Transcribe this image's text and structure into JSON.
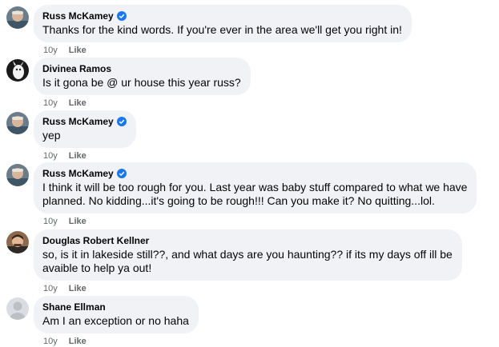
{
  "comments": [
    {
      "author": "Russ McKamey",
      "verified": true,
      "text": "Thanks for the kind words. If you're ever in the area we'll get you right in!",
      "time": "10y",
      "like_label": "Like",
      "avatar": "russ-avatar"
    },
    {
      "author": "Divinea Ramos",
      "verified": false,
      "text": "Is it gona be @ ur house this year russ?",
      "time": "10y",
      "like_label": "Like",
      "avatar": "divinea-avatar"
    },
    {
      "author": "Russ McKamey",
      "verified": true,
      "text": "yep",
      "time": "10y",
      "like_label": "Like",
      "avatar": "russ-avatar"
    },
    {
      "author": "Russ McKamey",
      "verified": true,
      "text_lines": [
        "I think it will be too rough for you. Last year was baby stuff compared to what we have",
        "planned. No kidding...it's going to be rough!!! Can you make it? No quitting...lol."
      ],
      "time": "10y",
      "like_label": "Like",
      "avatar": "russ-avatar"
    },
    {
      "author": "Douglas Robert Kellner",
      "verified": false,
      "text_lines": [
        "so, is it in lakeside still??, and what days are you haunting?? if its my days off ill be",
        "avaible to help ya out!"
      ],
      "time": "10y",
      "like_label": "Like",
      "avatar": "douglas-avatar"
    },
    {
      "author": "Shane Ellman",
      "verified": false,
      "text": "Am I an exception or no haha",
      "time": "10y",
      "like_label": "Like",
      "avatar": "default-avatar"
    }
  ],
  "colors": {
    "bubble": "#f0f2f5",
    "meta_text": "#65676b",
    "verified_badge": "#1877f2"
  }
}
